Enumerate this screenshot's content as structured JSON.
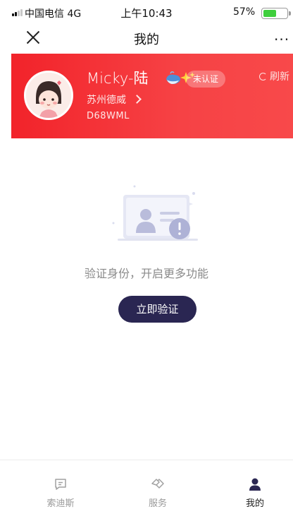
{
  "status_bar": {
    "carrier": "中国电信 4G",
    "time": "上午10:43",
    "battery_percent": "57%",
    "battery_level": 0.57
  },
  "nav": {
    "title": "我的",
    "more": "···"
  },
  "profile": {
    "name": "Micky-陆",
    "badge": "未认证",
    "refresh": "刷新",
    "company": "苏州德威",
    "code": "D68WML"
  },
  "verify": {
    "message": "验证身份，开启更多功能",
    "button": "立即验证"
  },
  "tabs": [
    {
      "label": "索迪斯",
      "icon": "message-icon",
      "active": false
    },
    {
      "label": "服务",
      "icon": "handshake-icon",
      "active": false
    },
    {
      "label": "我的",
      "icon": "person-icon",
      "active": true
    }
  ],
  "colors": {
    "header_red": "#f2232a",
    "button_navy": "#2a2652",
    "battery_green": "#3fcf3d"
  }
}
